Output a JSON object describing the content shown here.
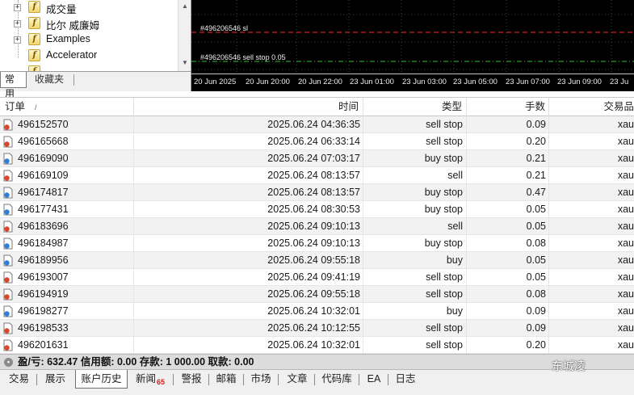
{
  "navigator": {
    "items": [
      {
        "label": "成交量"
      },
      {
        "label": "比尔 威廉姆"
      },
      {
        "label": "Examples"
      },
      {
        "label": "Accelerator"
      }
    ],
    "icon": "indicator-f-icon",
    "tabs": [
      {
        "label": "常用",
        "active": true
      },
      {
        "label": "收藏夹",
        "active": false
      }
    ]
  },
  "chart": {
    "background": "#000000",
    "order_lines": [
      {
        "label": "#496206546 sl",
        "color": "#ff2b2b"
      },
      {
        "label": "#496206546 sell stop 0.05",
        "color": "#2fbf2f"
      }
    ],
    "time_axis": [
      "20 Jun 2025",
      "20 Jun 20:00",
      "20 Jun 22:00",
      "23 Jun 01:00",
      "23 Jun 03:00",
      "23 Jun 05:00",
      "23 Jun 07:00",
      "23 Jun 09:00",
      "23 Ju"
    ]
  },
  "table": {
    "headers": {
      "order": "订单",
      "sort": "/",
      "time": "时间",
      "type": "类型",
      "lots": "手数",
      "symbol": "交易品"
    },
    "rows": [
      {
        "order": "496152570",
        "time": "2025.06.24 04:36:35",
        "type": "sell stop",
        "lots": "0.09",
        "symbol": "xau",
        "kind": "sell"
      },
      {
        "order": "496165668",
        "time": "2025.06.24 06:33:14",
        "type": "sell stop",
        "lots": "0.20",
        "symbol": "xau",
        "kind": "sell"
      },
      {
        "order": "496169090",
        "time": "2025.06.24 07:03:17",
        "type": "buy stop",
        "lots": "0.21",
        "symbol": "xau",
        "kind": "buy"
      },
      {
        "order": "496169109",
        "time": "2025.06.24 08:13:57",
        "type": "sell",
        "lots": "0.21",
        "symbol": "xau",
        "kind": "sell"
      },
      {
        "order": "496174817",
        "time": "2025.06.24 08:13:57",
        "type": "buy stop",
        "lots": "0.47",
        "symbol": "xau",
        "kind": "buy"
      },
      {
        "order": "496177431",
        "time": "2025.06.24 08:30:53",
        "type": "buy stop",
        "lots": "0.05",
        "symbol": "xau",
        "kind": "buy"
      },
      {
        "order": "496183696",
        "time": "2025.06.24 09:10:13",
        "type": "sell",
        "lots": "0.05",
        "symbol": "xau",
        "kind": "sell"
      },
      {
        "order": "496184987",
        "time": "2025.06.24 09:10:13",
        "type": "buy stop",
        "lots": "0.08",
        "symbol": "xau",
        "kind": "buy"
      },
      {
        "order": "496189956",
        "time": "2025.06.24 09:55:18",
        "type": "buy",
        "lots": "0.05",
        "symbol": "xau",
        "kind": "buy"
      },
      {
        "order": "496193007",
        "time": "2025.06.24 09:41:19",
        "type": "sell stop",
        "lots": "0.05",
        "symbol": "xau",
        "kind": "sell"
      },
      {
        "order": "496194919",
        "time": "2025.06.24 09:55:18",
        "type": "sell stop",
        "lots": "0.08",
        "symbol": "xau",
        "kind": "sell"
      },
      {
        "order": "496198277",
        "time": "2025.06.24 10:32:01",
        "type": "buy",
        "lots": "0.09",
        "symbol": "xau",
        "kind": "buy"
      },
      {
        "order": "496198533",
        "time": "2025.06.24 10:12:55",
        "type": "sell stop",
        "lots": "0.09",
        "symbol": "xau",
        "kind": "sell"
      },
      {
        "order": "496201631",
        "time": "2025.06.24 10:32:01",
        "type": "sell stop",
        "lots": "0.20",
        "symbol": "xau",
        "kind": "sell"
      }
    ],
    "colors": {
      "sell_icon": "#d9482b",
      "buy_icon": "#2f7fd9"
    }
  },
  "summary": {
    "text": "盈/亏: 632.47  信用额: 0.00  存款: 1 000.00  取款: 0.00"
  },
  "bottom_tabs": [
    {
      "label": "交易",
      "active": false
    },
    {
      "label": "展示",
      "active": false
    },
    {
      "label": "账户历史",
      "active": true
    },
    {
      "label": "新闻",
      "badge": "65",
      "active": false
    },
    {
      "label": "警报",
      "active": false
    },
    {
      "label": "邮箱",
      "active": false
    },
    {
      "label": "市场",
      "active": false
    },
    {
      "label": "文章",
      "active": false
    },
    {
      "label": "代码库",
      "active": false
    },
    {
      "label": "EA",
      "active": false
    },
    {
      "label": "日志",
      "active": false
    }
  ],
  "watermark": "东城凌"
}
